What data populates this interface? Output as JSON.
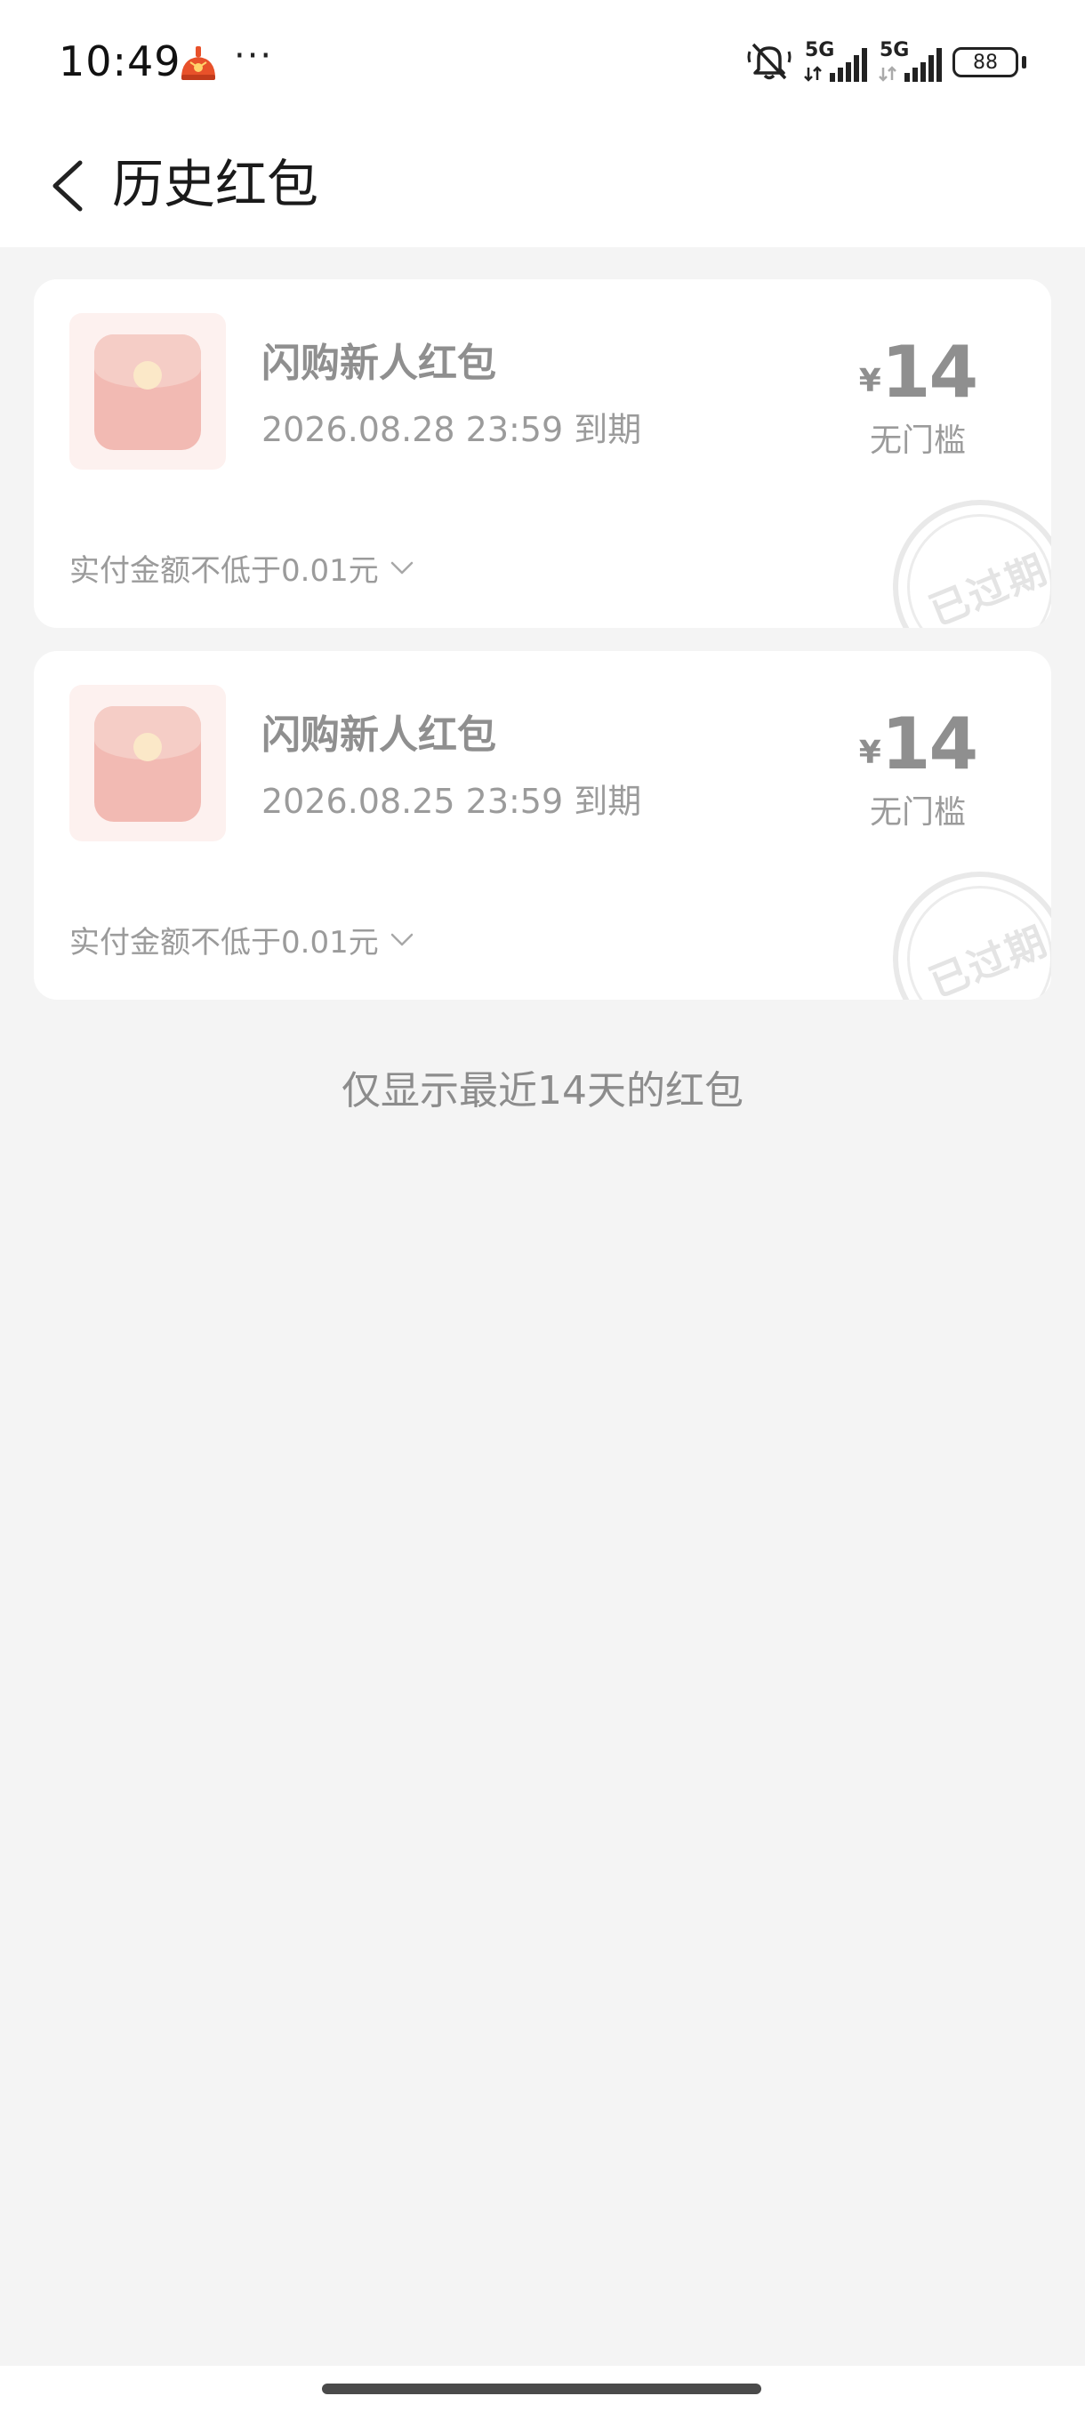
{
  "status_bar": {
    "time": "10:49",
    "more": "···",
    "icons": [
      "silent-bell-icon",
      "signal-5g-icon",
      "signal-5g-icon",
      "battery-icon"
    ],
    "sim1_label": "5G",
    "sim2_label": "5G",
    "battery": "88"
  },
  "header": {
    "back_icon": "chevron-left-icon",
    "title": "历史红包"
  },
  "coupons": [
    {
      "name": "闪购新人红包",
      "expire": "2026.08.28 23:59 到期",
      "currency": "¥",
      "amount": "14",
      "threshold": "无门槛",
      "condition": "实付金额不低于0.01元",
      "stamp": "已过期"
    },
    {
      "name": "闪购新人红包",
      "expire": "2026.08.25 23:59 到期",
      "currency": "¥",
      "amount": "14",
      "threshold": "无门槛",
      "condition": "实付金额不低于0.01元",
      "stamp": "已过期"
    }
  ],
  "footer_note": "仅显示最近14天的红包",
  "colors": {
    "page_bg": "#f4f4f4",
    "card_bg": "#ffffff",
    "muted_text": "#8f8f8f",
    "thumb_bg": "#fdf1ef",
    "thumb_bag": "#f2bab3"
  }
}
